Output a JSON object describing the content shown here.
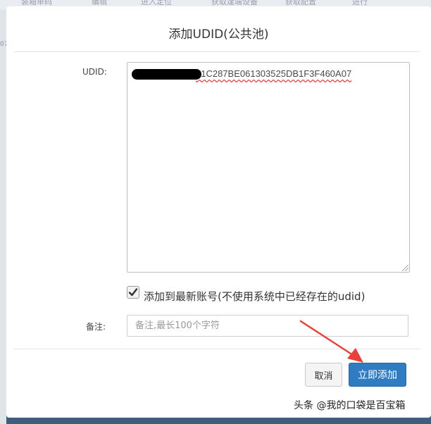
{
  "background": {
    "strip_items": [
      "装箱单码",
      "编辑",
      "进入定位",
      "获取逢端设备",
      "获取配置",
      "进行"
    ],
    "edge_text": "07"
  },
  "modal": {
    "title": "添加UDID(公共池)",
    "udid_label": "UDID:",
    "udid_visible_value": "71C287BE061303525DB1F3F460A07",
    "checkbox_checked": true,
    "checkbox_label": "添加到最新账号(不使用系统中已经存在的udid)",
    "note_label": "备注:",
    "note_placeholder": "备注,最长100个字符",
    "cancel_label": "取消",
    "submit_label": "立即添加"
  },
  "watermark": "头条 @我的口袋是百宝箱",
  "colors": {
    "primary_button": "#2f7cc2",
    "annotation_arrow": "#e8413b",
    "backdrop": "#3d5f7d"
  }
}
